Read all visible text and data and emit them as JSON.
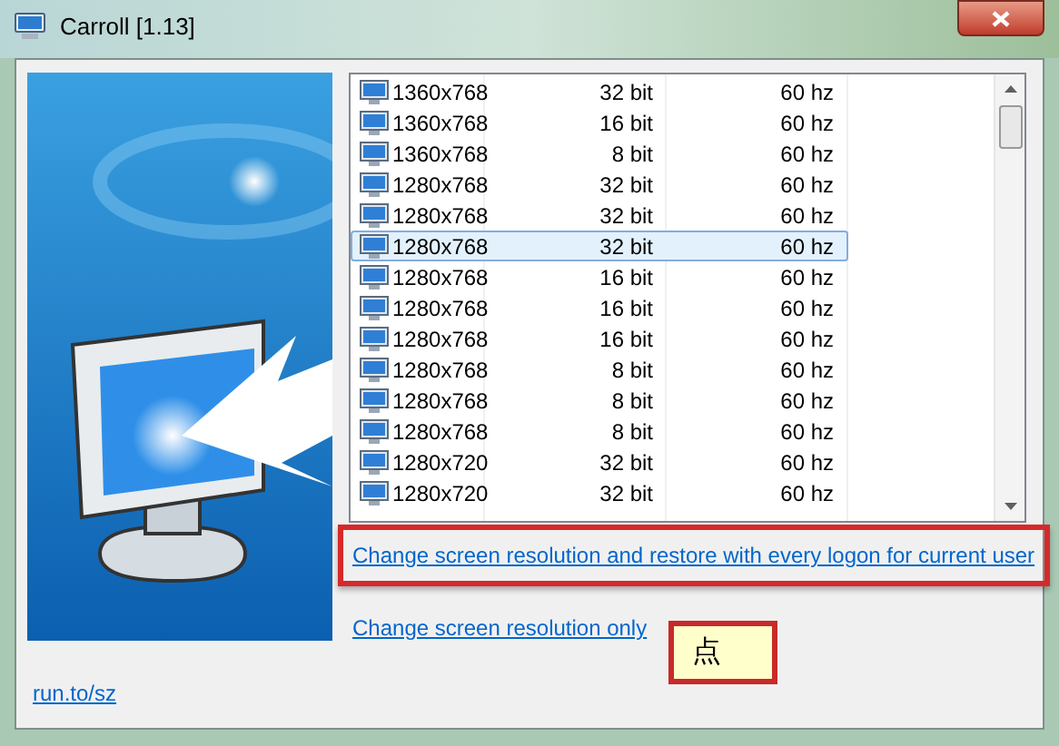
{
  "window": {
    "title": "Carroll [1.13]"
  },
  "modes": [
    {
      "resolution": "1360x768",
      "depth": "32 bit",
      "refresh": "60 hz",
      "selected": false
    },
    {
      "resolution": "1360x768",
      "depth": "16 bit",
      "refresh": "60 hz",
      "selected": false
    },
    {
      "resolution": "1360x768",
      "depth": "8 bit",
      "refresh": "60 hz",
      "selected": false
    },
    {
      "resolution": "1280x768",
      "depth": "32 bit",
      "refresh": "60 hz",
      "selected": false
    },
    {
      "resolution": "1280x768",
      "depth": "32 bit",
      "refresh": "60 hz",
      "selected": false
    },
    {
      "resolution": "1280x768",
      "depth": "32 bit",
      "refresh": "60 hz",
      "selected": true
    },
    {
      "resolution": "1280x768",
      "depth": "16 bit",
      "refresh": "60 hz",
      "selected": false
    },
    {
      "resolution": "1280x768",
      "depth": "16 bit",
      "refresh": "60 hz",
      "selected": false
    },
    {
      "resolution": "1280x768",
      "depth": "16 bit",
      "refresh": "60 hz",
      "selected": false
    },
    {
      "resolution": "1280x768",
      "depth": "8 bit",
      "refresh": "60 hz",
      "selected": false
    },
    {
      "resolution": "1280x768",
      "depth": "8 bit",
      "refresh": "60 hz",
      "selected": false
    },
    {
      "resolution": "1280x768",
      "depth": "8 bit",
      "refresh": "60 hz",
      "selected": false
    },
    {
      "resolution": "1280x720",
      "depth": "32 bit",
      "refresh": "60 hz",
      "selected": false
    },
    {
      "resolution": "1280x720",
      "depth": "32 bit",
      "refresh": "60 hz",
      "selected": false
    }
  ],
  "links": [
    {
      "label": "Change screen resolution and restore with every logon for current user",
      "highlighted": true
    },
    {
      "label": "Change screen resolution only",
      "highlighted": false
    }
  ],
  "callout": {
    "text": "点"
  },
  "footer_link": "run.to/sz"
}
